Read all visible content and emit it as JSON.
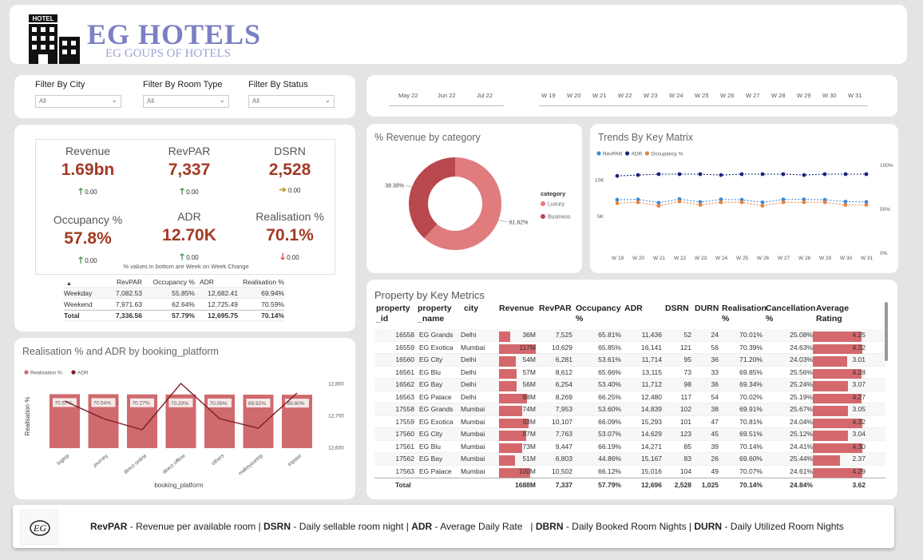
{
  "header": {
    "title": "EG HOTELS",
    "subtitle": "EG GOUPS OF HOTELS",
    "logo_text": "HOTEL"
  },
  "filters": [
    {
      "label": "Filter By City",
      "value": "All"
    },
    {
      "label": "Filter By Room Type",
      "value": "All"
    },
    {
      "label": "Filter By Status",
      "value": "All"
    }
  ],
  "months": [
    "May 22",
    "Jun 22",
    "Jul 22"
  ],
  "weeks": [
    "W 19",
    "W 20",
    "W 21",
    "W 22",
    "W 23",
    "W 24",
    "W 25",
    "W 26",
    "W 27",
    "W 28",
    "W 29",
    "W 30",
    "W 31"
  ],
  "kpis": [
    {
      "title": "Revenue",
      "value": "1.69bn",
      "delta": "0.00",
      "trend": "up"
    },
    {
      "title": "RevPAR",
      "value": "7,337",
      "delta": "0.00",
      "trend": "up"
    },
    {
      "title": "DSRN",
      "value": "2,528",
      "delta": "0.00",
      "trend": "flat"
    },
    {
      "title": "Occupancy %",
      "value": "57.8%",
      "delta": "0.00",
      "trend": "up"
    },
    {
      "title": "ADR",
      "value": "12.70K",
      "delta": "0.00",
      "trend": "up"
    },
    {
      "title": "Realisation %",
      "value": "70.1%",
      "delta": "0.00",
      "trend": "down"
    }
  ],
  "kpi_note": "% values in bottom are Week on Week Change",
  "day_table": {
    "headers": [
      "",
      "RevPAR",
      "Occupancy %",
      "ADR",
      "Realisation %"
    ],
    "rows": [
      [
        "Weekday",
        "7,082.53",
        "55.85%",
        "12,682.41",
        "69.94%"
      ],
      [
        "Weekend",
        "7,971.63",
        "62.64%",
        "12,725.49",
        "70.59%"
      ],
      [
        "Total",
        "7,336.56",
        "57.79%",
        "12,695.75",
        "70.14%"
      ]
    ]
  },
  "revcat": {
    "title": "% Revenue by category",
    "legend_title": "category"
  },
  "trends": {
    "title": "Trends By Key Matrix",
    "y_left_ticks": [
      "10K",
      "5K"
    ],
    "y_right_ticks": [
      "100%",
      "50%",
      "0%"
    ]
  },
  "realis": {
    "title": "Realisation % and ADR by booking_platform",
    "y_left_label": "Realisation %",
    "x_label": "booking_platform",
    "y_right_ticks": [
      "12,800",
      "12,700",
      "12,600"
    ]
  },
  "prop": {
    "title": "Property by Key Metrics",
    "headers": [
      "property _id",
      "property _name",
      "city",
      "Revenue",
      "RevPAR",
      "Occupancy %",
      "ADR",
      "DSRN",
      "DURN",
      "Realisation %",
      "Cancellation %",
      "Average Rating"
    ],
    "rows": [
      [
        "16558",
        "EG Grands",
        "Delhi",
        "36M",
        "7,525",
        "65.81%",
        "11,436",
        "52",
        "24",
        "70.01%",
        "25.08%",
        "4.25"
      ],
      [
        "16559",
        "EG Exotica",
        "Mumbai",
        "117M",
        "10,629",
        "65.85%",
        "16,141",
        "121",
        "56",
        "70.39%",
        "24.63%",
        "4.32"
      ],
      [
        "16560",
        "EG City",
        "Delhi",
        "54M",
        "6,281",
        "53.61%",
        "11,714",
        "95",
        "36",
        "71.20%",
        "24.03%",
        "3.01"
      ],
      [
        "16561",
        "EG Blu",
        "Delhi",
        "57M",
        "8,612",
        "65.66%",
        "13,115",
        "73",
        "33",
        "69.85%",
        "25.56%",
        "4.28"
      ],
      [
        "16562",
        "EG Bay",
        "Delhi",
        "56M",
        "6,254",
        "53.40%",
        "11,712",
        "98",
        "36",
        "69.34%",
        "25.24%",
        "3.07"
      ],
      [
        "16563",
        "EG Palace",
        "Delhi",
        "88M",
        "8,269",
        "66.25%",
        "12,480",
        "117",
        "54",
        "70.02%",
        "25.19%",
        "4.27"
      ],
      [
        "17558",
        "EG Grands",
        "Mumbai",
        "74M",
        "7,953",
        "53.60%",
        "14,839",
        "102",
        "38",
        "69.91%",
        "25.67%",
        "3.05"
      ],
      [
        "17559",
        "EG Exotica",
        "Mumbai",
        "93M",
        "10,107",
        "66.09%",
        "15,293",
        "101",
        "47",
        "70.81%",
        "24.04%",
        "4.32"
      ],
      [
        "17560",
        "EG City",
        "Mumbai",
        "87M",
        "7,763",
        "53.07%",
        "14,629",
        "123",
        "45",
        "69.51%",
        "25.12%",
        "3.04"
      ],
      [
        "17561",
        "EG Blu",
        "Mumbai",
        "73M",
        "9,447",
        "66.19%",
        "14,271",
        "85",
        "39",
        "70.14%",
        "24.41%",
        "4.30"
      ],
      [
        "17562",
        "EG Bay",
        "Mumbai",
        "51M",
        "6,803",
        "44.86%",
        "15,167",
        "83",
        "26",
        "69.60%",
        "25.44%",
        "2.37"
      ],
      [
        "17563",
        "EG Palace",
        "Mumbai",
        "100M",
        "10,502",
        "66.12%",
        "15,016",
        "104",
        "49",
        "70.07%",
        "24.61%",
        "4.29"
      ]
    ],
    "total": [
      "Total",
      "",
      "",
      "1688M",
      "7,337",
      "57.79%",
      "12,696",
      "2,528",
      "1,025",
      "70.14%",
      "24.84%",
      "3.62"
    ]
  },
  "footer": {
    "segments": [
      {
        "abbr": "RevPAR",
        "desc": " - Revenue per available room | "
      },
      {
        "abbr": "DSRN",
        "desc": " - Daily sellable room night | "
      },
      {
        "abbr": "ADR",
        "desc": " - Average Daily Rate   | "
      },
      {
        "abbr": "DBRN",
        "desc": " - Daily Booked Room Nights | "
      },
      {
        "abbr": "DURN",
        "desc": " - Daily Utilized Room Nights"
      }
    ],
    "logo_text": "EG"
  },
  "chart_data": [
    {
      "type": "pie",
      "title": "% Revenue by category",
      "categories": [
        "Luxury",
        "Business"
      ],
      "values": [
        61.62,
        38.38
      ],
      "labels": [
        "61.62%",
        "38.38%"
      ],
      "colors": [
        "#e07b7e",
        "#b8484d"
      ],
      "legend_title": "category"
    },
    {
      "type": "line",
      "title": "Trends By Key Matrix",
      "categories": [
        "W 19",
        "W 20",
        "W 21",
        "W 22",
        "W 23",
        "W 24",
        "W 25",
        "W 26",
        "W 27",
        "W 28",
        "W 29",
        "W 30",
        "W 31"
      ],
      "series": [
        {
          "name": "RevPAR",
          "axis": "left",
          "values": [
            7300,
            7350,
            6900,
            7400,
            7000,
            7350,
            7300,
            6950,
            7350,
            7350,
            7300,
            7050,
            7000
          ]
        },
        {
          "name": "ADR",
          "axis": "right",
          "values": [
            88,
            89,
            90,
            90,
            90,
            89,
            90,
            90,
            90,
            89,
            90,
            90,
            90
          ]
        },
        {
          "name": "Occupancy %",
          "axis": "right",
          "values": [
            57,
            58,
            54,
            59,
            55,
            58,
            58,
            54,
            58,
            58,
            58,
            55,
            55
          ]
        }
      ],
      "colors": [
        "#3c8ad8",
        "#1a237e",
        "#e8823a"
      ],
      "y_left_ticks": [
        "10K",
        "5K"
      ],
      "y_right_ticks": [
        "100%",
        "50%",
        "0%"
      ]
    },
    {
      "type": "bar",
      "title": "Realisation % and ADR by booking_platform",
      "categories": [
        "logtrip",
        "journey",
        "direct online",
        "direct offline",
        "others",
        "makeyourtrip",
        "tripster"
      ],
      "series": [
        {
          "name": "Realisation %",
          "values": [
            70.57,
            70.54,
            70.27,
            70.2,
            70.09,
            69.92,
            69.8
          ],
          "labels": [
            "70.57%",
            "70.54%",
            "70.27%",
            "70.20%",
            "70.09%",
            "69.92%",
            "69.80%"
          ]
        },
        {
          "name": "ADR",
          "values": [
            12745,
            12690,
            12655,
            12800,
            12690,
            12660,
            12770
          ]
        }
      ],
      "xlabel": "booking_platform",
      "ylabel": "Realisation %",
      "y_right_ticks": [
        "12,800",
        "12,700",
        "12,600"
      ],
      "colors": [
        "#cf6a6e",
        "#7b1e22"
      ]
    }
  ]
}
